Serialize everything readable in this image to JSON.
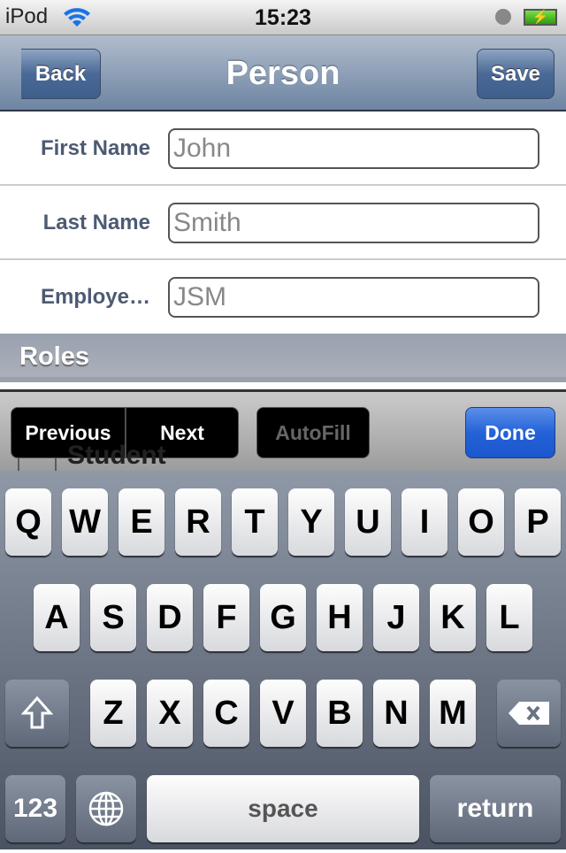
{
  "status": {
    "carrier": "iPod",
    "time": "15:23",
    "battery_icon": "battery-charging-icon",
    "wifi_icon": "wifi-icon",
    "clock_icon": "alarm-clock-icon"
  },
  "nav": {
    "title": "Person",
    "back": "Back",
    "save": "Save"
  },
  "form": [
    {
      "label": "First Name",
      "value": "John"
    },
    {
      "label": "Last Name",
      "value": "Smith"
    },
    {
      "label": "Employe…",
      "value": "JSM"
    }
  ],
  "roles": {
    "header": "Roles",
    "partial_item": "Student"
  },
  "toolbar": {
    "previous": "Previous",
    "next": "Next",
    "autofill": "AutoFill",
    "done": "Done",
    "done_color": "#2462d8"
  },
  "keyboard": {
    "row1": [
      "Q",
      "W",
      "E",
      "R",
      "T",
      "Y",
      "U",
      "I",
      "O",
      "P"
    ],
    "row2": [
      "A",
      "S",
      "D",
      "F",
      "G",
      "H",
      "J",
      "K",
      "L"
    ],
    "row3": [
      "Z",
      "X",
      "C",
      "V",
      "B",
      "N",
      "M"
    ],
    "numbers": "123",
    "space": "space",
    "return": "return",
    "shift_icon": "shift-icon",
    "globe_icon": "globe-icon",
    "delete_icon": "delete-icon"
  }
}
